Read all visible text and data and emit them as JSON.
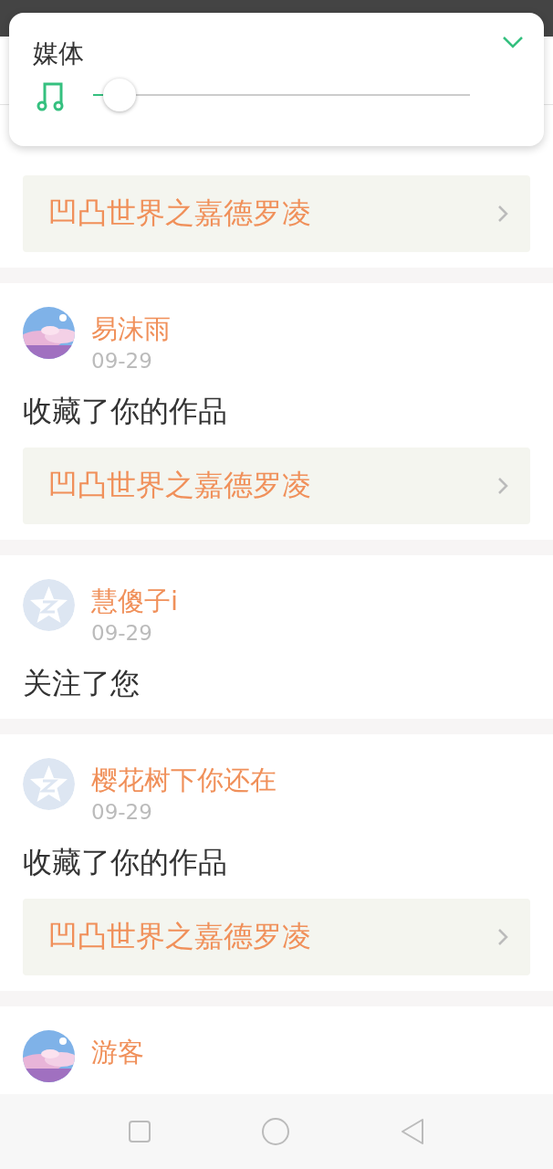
{
  "volume_panel": {
    "label": "媒体",
    "level": 0.07
  },
  "feed": [
    {
      "work": "凹凸世界之嘉德罗凌"
    },
    {
      "name": "易沫雨",
      "date": "09-29",
      "action": "收藏了你的作品",
      "work": "凹凸世界之嘉德罗凌"
    },
    {
      "avatar": {
        "kind": "default"
      },
      "name": "慧傻子i",
      "date": "09-29",
      "action": "关注了您"
    },
    {
      "avatar": {
        "kind": "default"
      },
      "name": "樱花树下你还在",
      "date": "09-29",
      "action": "收藏了你的作品",
      "work": "凹凸世界之嘉德罗凌"
    },
    {
      "name": "游客"
    }
  ]
}
